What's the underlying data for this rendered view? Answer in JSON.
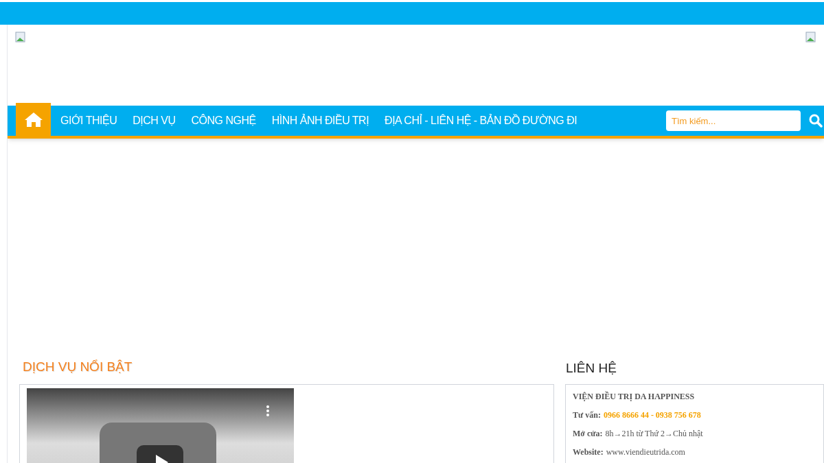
{
  "nav": {
    "home": {
      "selected": true
    },
    "items": [
      {
        "label": "GIỚI THIỆU",
        "selected": false
      },
      {
        "label": "DỊCH VỤ",
        "selected": false
      },
      {
        "label": "CÔNG NGHỆ",
        "selected": false
      },
      {
        "label": "HÌNH ẢNH ĐIỀU TRỊ",
        "selected": false
      },
      {
        "label": "ĐỊA CHỈ - LIÊN HỆ - BẢN ĐỒ ĐƯỜNG ĐI",
        "selected": false
      }
    ],
    "search": {
      "placeholder": "Tìm kiếm..."
    }
  },
  "featured": {
    "title": "DỊCH VỤ NỔI BẬT"
  },
  "contact": {
    "title": "LIÊN HỆ",
    "lines": [
      {
        "kind": "heading",
        "text": "VIỆN ĐIỀU TRỊ DA HAPPINESS"
      },
      {
        "kind": "field",
        "label": "Tư vấn:",
        "value": "0966 8666 44 - 0938 756 678",
        "highlight": true
      },
      {
        "kind": "field",
        "label": "Mở cửa:",
        "value": "8h→21h từ Thứ 2→Chủ nhật",
        "highlight": false
      },
      {
        "kind": "field",
        "label": "Website:",
        "value": "www.viendieutrida.com",
        "highlight": false
      }
    ]
  }
}
